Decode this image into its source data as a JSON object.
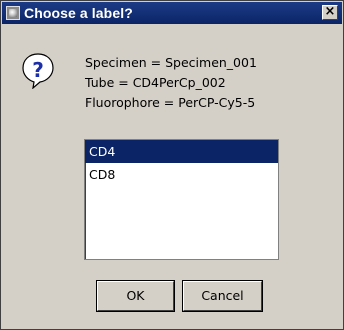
{
  "window": {
    "title": "Choose a label?",
    "close_glyph": "×"
  },
  "icons": {
    "app": "app-icon",
    "question": "question-icon",
    "close": "close-icon"
  },
  "info": {
    "specimen": "Specimen = Specimen_001",
    "tube": "Tube = CD4PerCp_002",
    "fluorophore": "Fluorophore = PerCP-Cy5-5"
  },
  "list": {
    "items": [
      {
        "label": "CD4",
        "selected": true
      },
      {
        "label": "CD8",
        "selected": false
      }
    ]
  },
  "buttons": {
    "ok": "OK",
    "cancel": "Cancel"
  },
  "colors": {
    "titlebar": "#0b2466",
    "selection": "#0b2466",
    "dialog_bg": "#d4d0c8",
    "question_blue": "#1c2fa8"
  }
}
